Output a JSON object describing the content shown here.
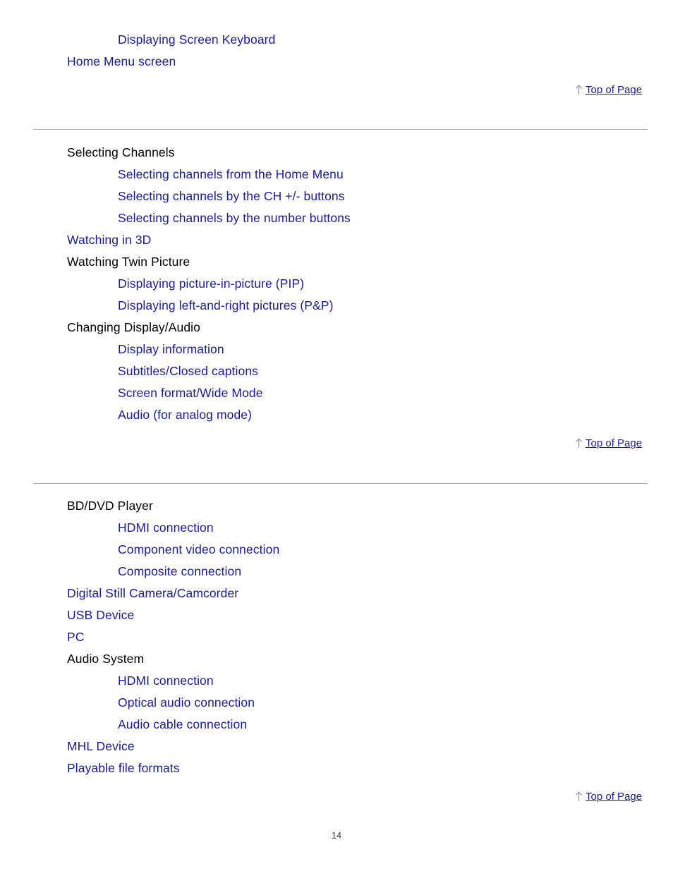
{
  "page": {
    "number": "14",
    "link_color": "#1a1a9c",
    "text_color": "#000000",
    "rule_color": "#aaaaaa",
    "arrow_color": "#9a9a9a"
  },
  "top_of_page": {
    "label": "Top of Page",
    "icon": "arrow-up-icon"
  },
  "sections": [
    {
      "id": "section-a",
      "entries": [
        {
          "label": "Displaying Screen Keyboard",
          "level": 2,
          "is_link": true
        },
        {
          "label": "Home Menu screen",
          "level": 1,
          "is_link": true
        }
      ]
    },
    {
      "id": "section-b",
      "entries": [
        {
          "label": "Selecting Channels",
          "level": 1,
          "is_link": false
        },
        {
          "label": "Selecting channels from the Home Menu",
          "level": 2,
          "is_link": true
        },
        {
          "label": "Selecting channels by the CH +/- buttons",
          "level": 2,
          "is_link": true
        },
        {
          "label": "Selecting channels by the number buttons",
          "level": 2,
          "is_link": true
        },
        {
          "label": "Watching in 3D",
          "level": 1,
          "is_link": true
        },
        {
          "label": "Watching Twin Picture",
          "level": 1,
          "is_link": false
        },
        {
          "label": "Displaying picture-in-picture (PIP)",
          "level": 2,
          "is_link": true
        },
        {
          "label": "Displaying left-and-right pictures (P&P)",
          "level": 2,
          "is_link": true
        },
        {
          "label": "Changing Display/Audio",
          "level": 1,
          "is_link": false
        },
        {
          "label": "Display information",
          "level": 2,
          "is_link": true
        },
        {
          "label": "Subtitles/Closed captions",
          "level": 2,
          "is_link": true
        },
        {
          "label": "Screen format/Wide Mode",
          "level": 2,
          "is_link": true
        },
        {
          "label": "Audio (for analog mode)",
          "level": 2,
          "is_link": true
        }
      ]
    },
    {
      "id": "section-c",
      "entries": [
        {
          "label": "BD/DVD Player",
          "level": 1,
          "is_link": false
        },
        {
          "label": "HDMI connection",
          "level": 2,
          "is_link": true
        },
        {
          "label": "Component video connection",
          "level": 2,
          "is_link": true
        },
        {
          "label": "Composite connection",
          "level": 2,
          "is_link": true
        },
        {
          "label": "Digital Still Camera/Camcorder",
          "level": 1,
          "is_link": true
        },
        {
          "label": "USB Device",
          "level": 1,
          "is_link": true
        },
        {
          "label": "PC",
          "level": 1,
          "is_link": true
        },
        {
          "label": "Audio System",
          "level": 1,
          "is_link": false
        },
        {
          "label": "HDMI connection",
          "level": 2,
          "is_link": true
        },
        {
          "label": "Optical audio connection",
          "level": 2,
          "is_link": true
        },
        {
          "label": "Audio cable connection",
          "level": 2,
          "is_link": true
        },
        {
          "label": "MHL Device",
          "level": 1,
          "is_link": true
        },
        {
          "label": "Playable file formats",
          "level": 1,
          "is_link": true
        }
      ]
    }
  ]
}
